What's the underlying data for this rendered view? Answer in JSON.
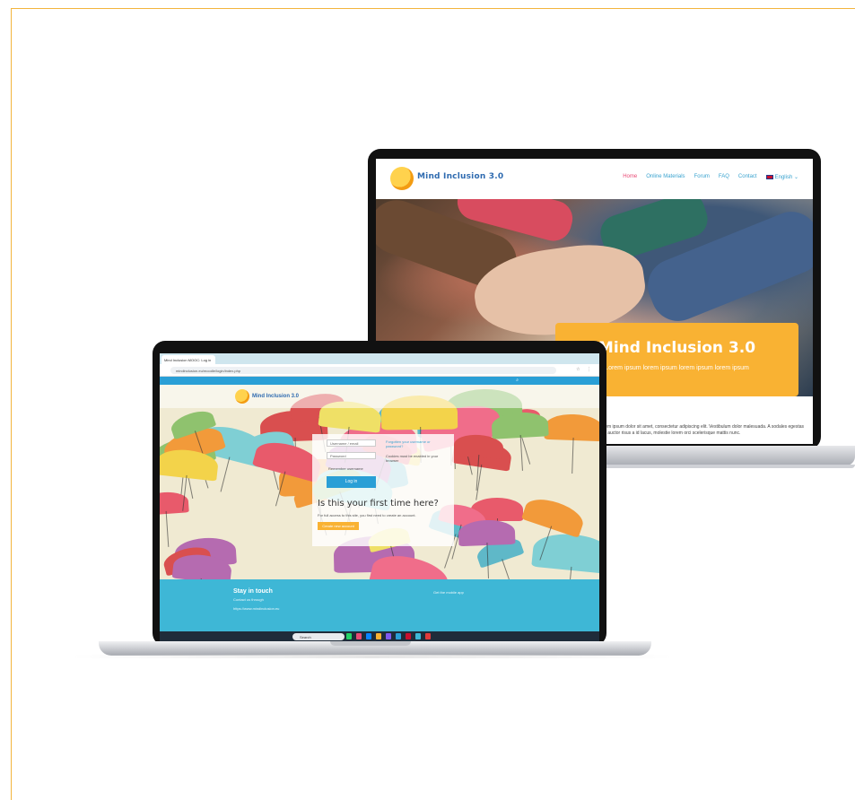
{
  "back_site": {
    "logo_text": "Mind Inclusion 3.0",
    "nav": [
      "Home",
      "Online Materials",
      "Forum",
      "FAQ",
      "Contact"
    ],
    "nav_active": "Home",
    "language": "English",
    "banner_title": "Mind Inclusion 3.0",
    "banner_subtitle": "Lorem ipsum lorem ipsum lorem ipsum lorem ipsum",
    "body_text": "Lorem ipsum dolor sit amet, consectetur adipiscing elit. Vestibulum dolor malesuada. A sodales egestas velit auctor risus a id lacus, molestie lorem orci scelerisque mattis nunc.",
    "colors": {
      "accent": "#f9b233",
      "nav": "#3aa3cf",
      "nav_active": "#e94a75"
    }
  },
  "front_site": {
    "browser_tab": "Mind Inclusion MOOC: Log in",
    "address": "mindinclusion.eu/moodle/login/index.php",
    "logo_text": "Mind Inclusion 3.0",
    "username_placeholder": "Username / email",
    "password_placeholder": "Password",
    "forgotten_link": "Forgotten your username or password?",
    "cookies_note": "Cookies must be enabled in your browser",
    "remember_label": "Remember username",
    "login_button": "Log in",
    "first_time_title": "Is this your first time here?",
    "first_time_text": "For full access to this site, you first need to create an account.",
    "create_account_button": "Create new account",
    "footer_title": "Stay in touch",
    "footer_sub": "Contact us through",
    "footer_link": "https://www.mindinclusion.eu",
    "footer_right": "Get the mobile app",
    "taskbar_search": "Search",
    "colors": {
      "primary": "#2a9fd6",
      "footer": "#3eb7d6",
      "accent": "#f9b233"
    }
  }
}
